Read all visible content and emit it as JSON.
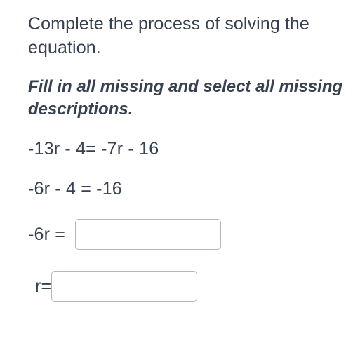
{
  "instructions": {
    "line1": "Complete the process of solving the equation.",
    "line2": "Fill in all missing and select all missing descriptions."
  },
  "equations": {
    "step1": "-13r - 4= -7r - 16",
    "step2": "-6r - 4 = -16",
    "step3_lhs": "-6r =",
    "step4_lhs": "r="
  },
  "inputs": {
    "box1_value": "",
    "box2_value": ""
  }
}
